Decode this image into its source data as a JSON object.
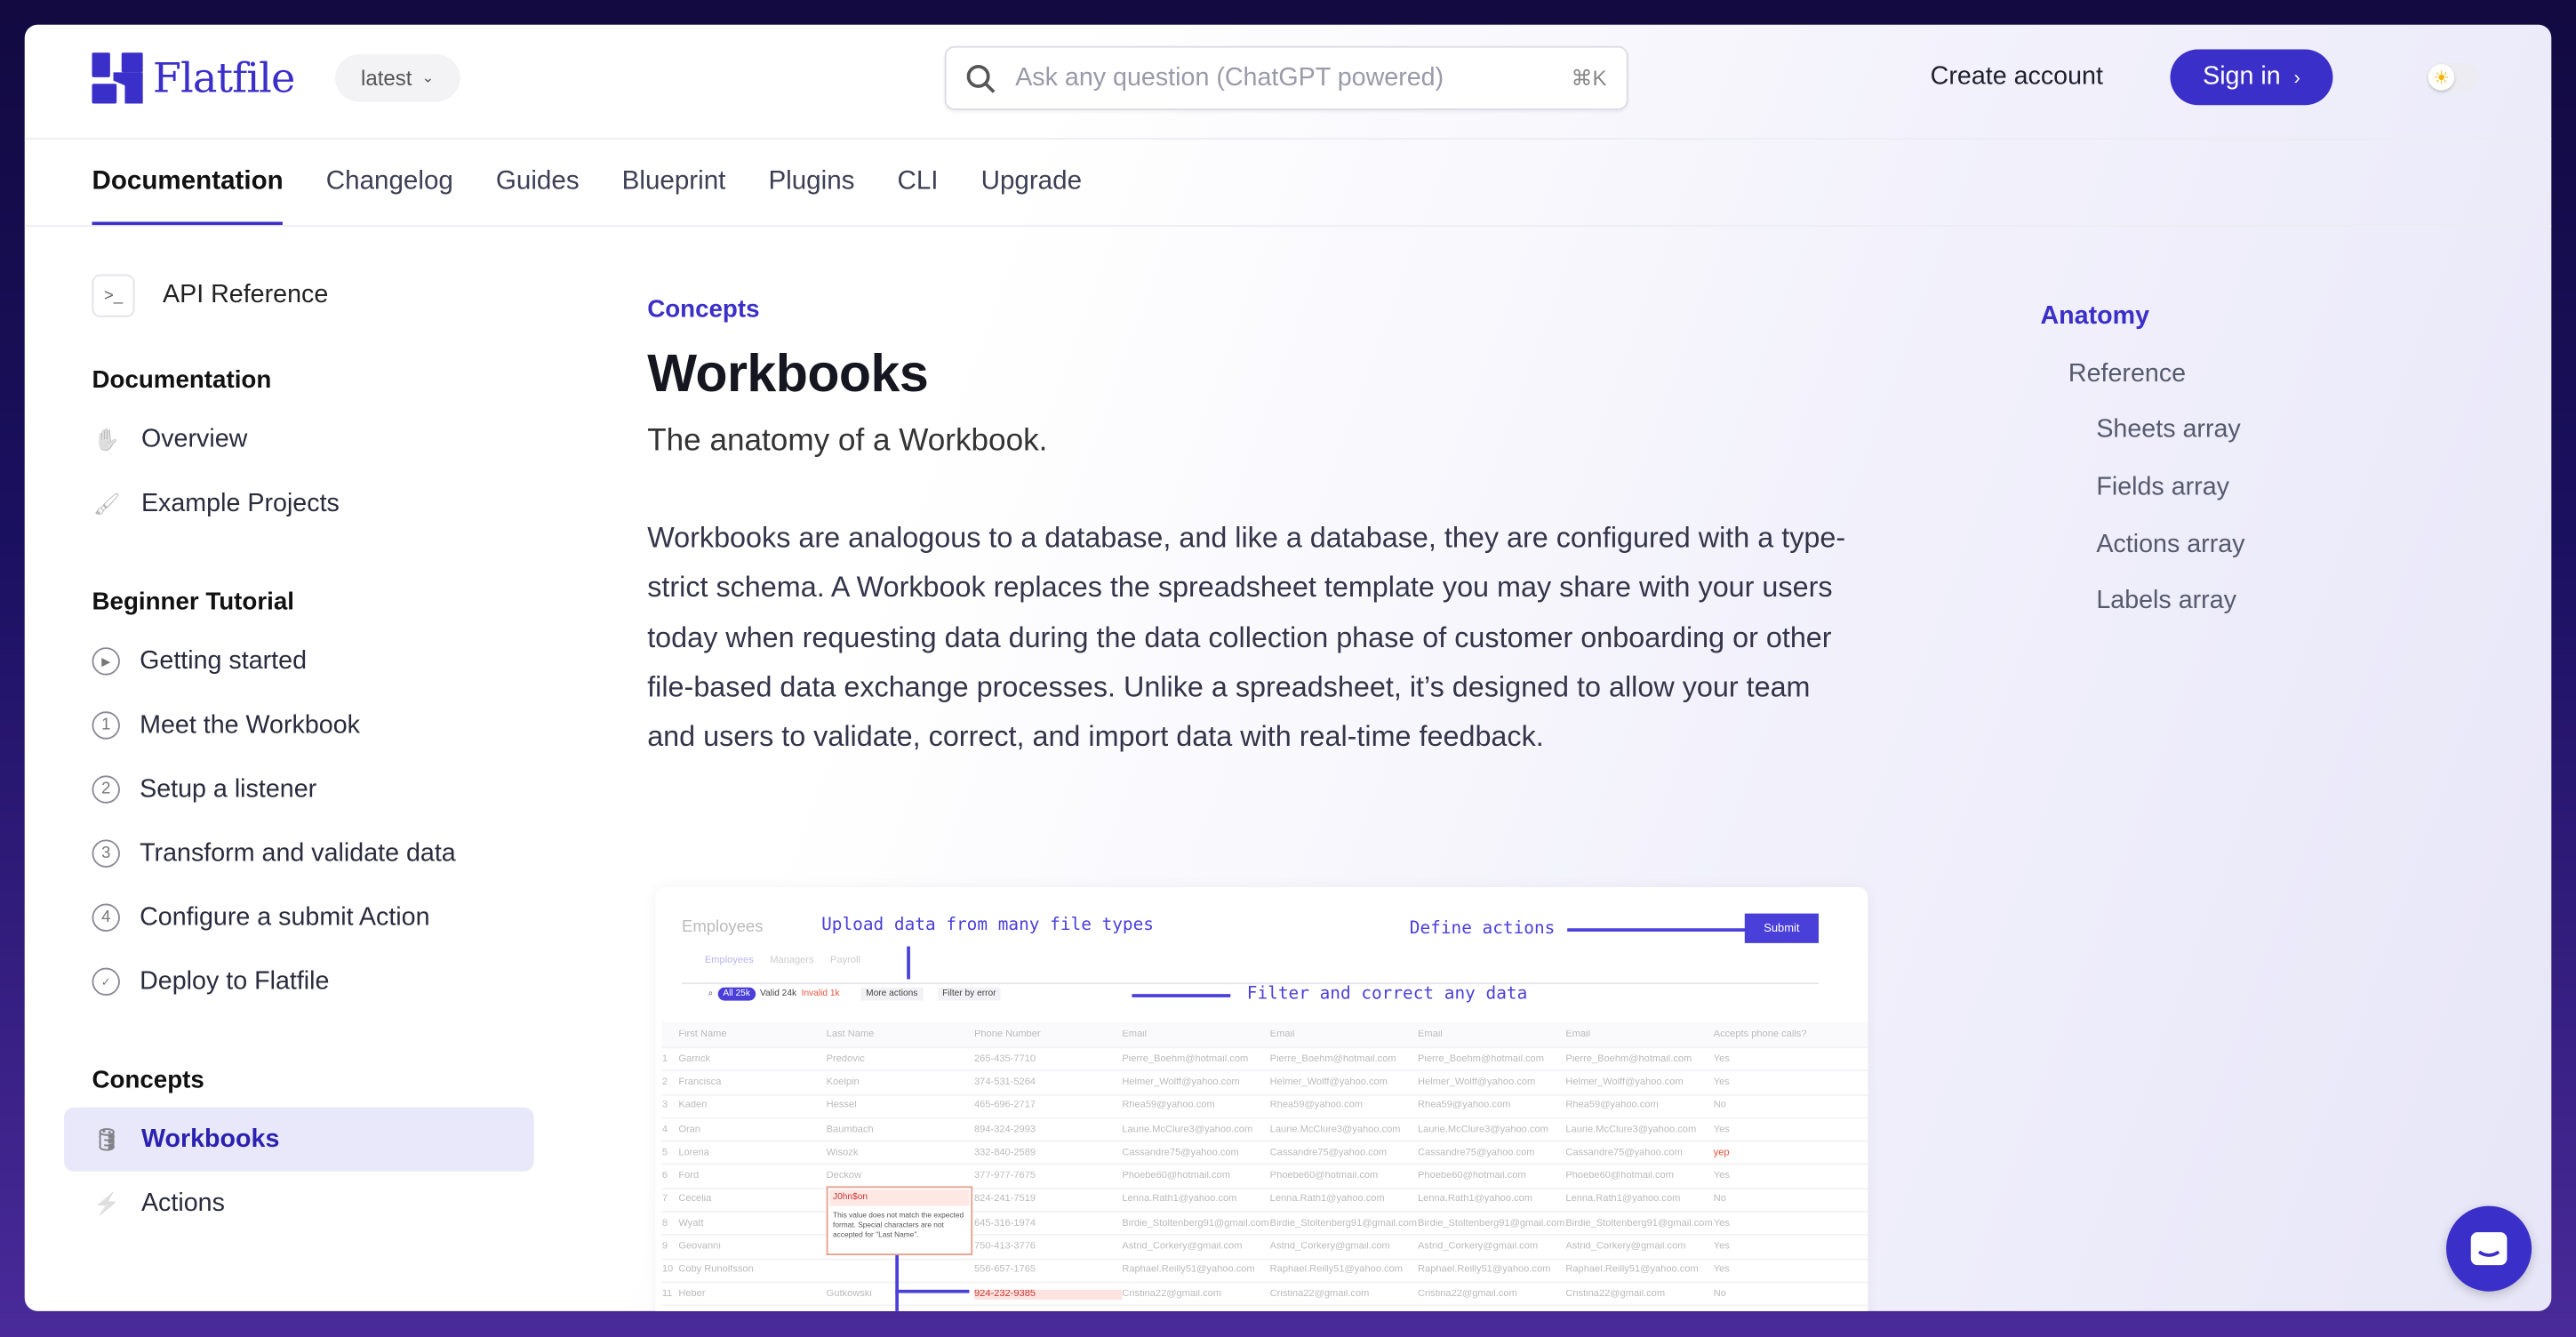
{
  "header": {
    "brand": "Flatfile",
    "version": "latest",
    "search_placeholder": "Ask any question (ChatGPT powered)",
    "search_shortcut": "⌘K",
    "create_account": "Create account",
    "sign_in": "Sign in"
  },
  "nav": {
    "tabs": [
      "Documentation",
      "Changelog",
      "Guides",
      "Blueprint",
      "Plugins",
      "CLI",
      "Upgrade"
    ],
    "active": "Documentation"
  },
  "sidebar": {
    "api_reference": "API Reference",
    "sections": [
      {
        "title": "Documentation",
        "items": [
          {
            "label": "Overview",
            "icon": "wave-hand-icon"
          },
          {
            "label": "Example Projects",
            "icon": "brush-icon"
          }
        ]
      },
      {
        "title": "Beginner Tutorial",
        "items": [
          {
            "label": "Getting started",
            "icon": "play-circle-icon"
          },
          {
            "label": "Meet the Workbook",
            "icon": "1"
          },
          {
            "label": "Setup a listener",
            "icon": "2"
          },
          {
            "label": "Transform and validate data",
            "icon": "3"
          },
          {
            "label": "Configure a submit Action",
            "icon": "4"
          },
          {
            "label": "Deploy to Flatfile",
            "icon": "check-circle-icon"
          }
        ]
      },
      {
        "title": "Concepts",
        "items": [
          {
            "label": "Workbooks",
            "icon": "database-icon",
            "selected": true
          },
          {
            "label": "Actions",
            "icon": "bolt-icon"
          }
        ]
      }
    ]
  },
  "main": {
    "eyebrow": "Concepts",
    "title": "Workbooks",
    "subtitle": "The anatomy of a Workbook.",
    "paragraph": "Workbooks are analogous to a database, and like a database, they are configured with a type-strict schema. A Workbook replaces the spreadsheet template you may share with your users today when requesting data during the data collection phase of customer onboarding or other file-based data exchange processes. Unlike a spreadsheet, it’s designed to allow your team and users to validate, correct, and import data with real-time feedback."
  },
  "illustration": {
    "title": "Employees",
    "sheet_tabs": [
      "Employees",
      "Managers",
      "Payroll"
    ],
    "annotations": {
      "upload": "Upload data from many file types",
      "actions": "Define actions",
      "filter": "Filter and correct any data"
    },
    "submit": "Submit",
    "filters": {
      "all": "All 25k",
      "valid": "Valid 24k",
      "invalid": "Invalid 1k"
    },
    "more_actions": "More actions",
    "filter_by_error": "Filter by error",
    "columns": [
      "",
      "First Name",
      "Last Name",
      "Phone Number",
      "Email",
      "Email",
      "Email",
      "Email",
      "Accepts phone calls?"
    ],
    "rows": [
      [
        "1",
        "Garrick",
        "Predovic",
        "265-435-7710",
        "Pierre_Boehm@hotmail.com",
        "Yes"
      ],
      [
        "2",
        "Francisca",
        "Koelpin",
        "374-531-5264",
        "Helmer_Wolff@yahoo.com",
        "Yes"
      ],
      [
        "3",
        "Kaden",
        "Hessel",
        "465-696-2717",
        "Rhea59@yahoo.com",
        "No"
      ],
      [
        "4",
        "Oran",
        "Baumbach",
        "894-324-2993",
        "Laurie.McClure3@yahoo.com",
        "Yes"
      ],
      [
        "5",
        "Lorena",
        "Wisozk",
        "332-840-2589",
        "Cassandre75@yahoo.com",
        "yep"
      ],
      [
        "6",
        "Ford",
        "Deckow",
        "377-977-7675",
        "Phoebe60@hotmail.com",
        "Yes"
      ],
      [
        "7",
        "Cecelia",
        "J0hn$on",
        "824-241-7519",
        "Lenna.Rath1@yahoo.com",
        "No"
      ],
      [
        "8",
        "Wyatt",
        "",
        "645-316-1974",
        "Birdie_Stoltenberg91@gmail.com",
        "Yes"
      ],
      [
        "9",
        "Geovanni",
        "",
        "750-413-3776",
        "Astrid_Corkery@gmail.com",
        "Yes"
      ],
      [
        "10",
        "Coby Runolfsson",
        "",
        "556-657-1765",
        "Raphael.Reilly51@yahoo.com",
        "Yes"
      ],
      [
        "11",
        "Heber",
        "Gutkowski",
        "924-232-9385",
        "Cristina22@gmail.com",
        "No"
      ]
    ],
    "error_message": "This value does not match the expected format. Special characters are not accepted for \"Last Name\"."
  },
  "toc": {
    "items": [
      {
        "label": "Anatomy",
        "level": 0,
        "active": true
      },
      {
        "label": "Reference",
        "level": 1
      },
      {
        "label": "Sheets array",
        "level": 2
      },
      {
        "label": "Fields array",
        "level": 2
      },
      {
        "label": "Actions array",
        "level": 2
      },
      {
        "label": "Labels array",
        "level": 2
      }
    ]
  },
  "colors": {
    "accent": "#3b2fc9",
    "error": "#e5533d"
  }
}
